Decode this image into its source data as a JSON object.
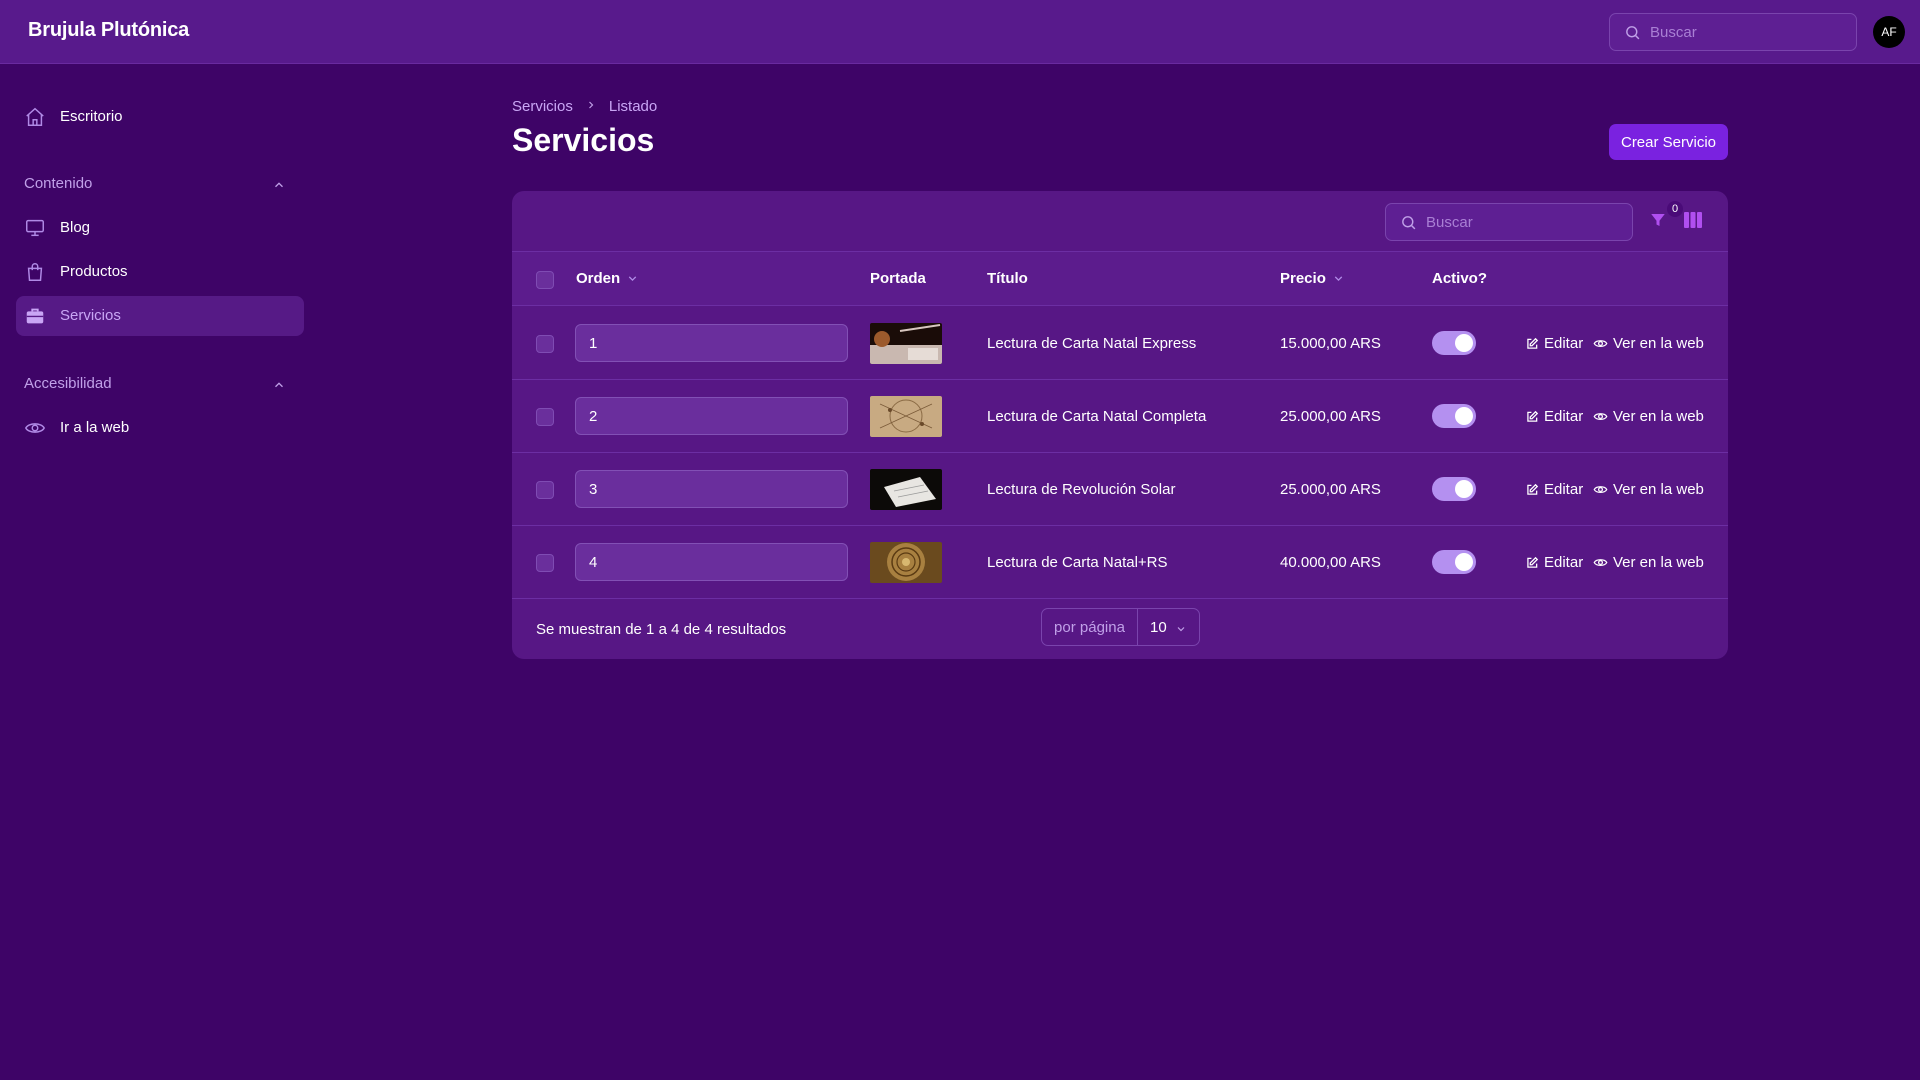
{
  "app": {
    "brand": "Brujula Plutónica",
    "user_initials": "AF"
  },
  "top_search": {
    "placeholder": "Buscar"
  },
  "sidebar": {
    "dashboard": "Escritorio",
    "groups": [
      {
        "label": "Contenido",
        "items": [
          "Blog",
          "Productos",
          "Servicios"
        ]
      },
      {
        "label": "Accesibilidad",
        "items": [
          "Ir a la web"
        ]
      }
    ],
    "active": "Servicios"
  },
  "breadcrumb": [
    "Servicios",
    "Listado"
  ],
  "page": {
    "title": "Servicios",
    "create_label": "Crear Servicio"
  },
  "table": {
    "search_placeholder": "Buscar",
    "filter_count": "0",
    "columns": {
      "order": "Orden",
      "cover": "Portada",
      "title": "Título",
      "price": "Precio",
      "active": "Activo?"
    },
    "rows": [
      {
        "order": "1",
        "title": "Lectura de Carta Natal Express",
        "price": "15.000,00 ARS",
        "active": true
      },
      {
        "order": "2",
        "title": "Lectura de Carta Natal Completa",
        "price": "25.000,00 ARS",
        "active": true
      },
      {
        "order": "3",
        "title": "Lectura de Revolución Solar",
        "price": "25.000,00 ARS",
        "active": true
      },
      {
        "order": "4",
        "title": "Lectura de Carta Natal+RS",
        "price": "40.000,00 ARS",
        "active": true
      }
    ],
    "edit_label": "Editar",
    "view_label": "Ver en la web",
    "summary": "Se muestran de 1 a 4 de 4 resultados",
    "per_page_label": "por página",
    "per_page_value": "10"
  },
  "colors": {
    "background": "#3e0467",
    "topbar": "#581a8c",
    "card": "#571785",
    "accent": "#7a22e0",
    "toggle": "#b490f0"
  }
}
